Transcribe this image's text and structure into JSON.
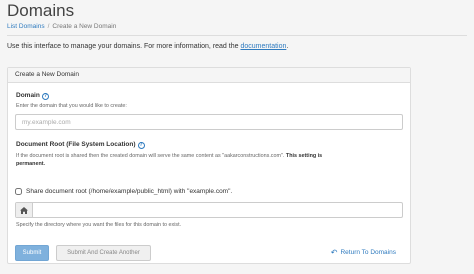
{
  "page": {
    "title": "Domains"
  },
  "breadcrumb": {
    "parent": "List Domains",
    "separator": "/",
    "current": "Create a New Domain"
  },
  "intro": {
    "text_before": "Use this interface to manage your domains. For more information, read the ",
    "link": "documentation",
    "text_after": "."
  },
  "panel": {
    "heading": "Create a New Domain",
    "domain": {
      "label": "Domain",
      "help_icon": "question-circle-icon",
      "hint": "Enter the domain that you would like to create:",
      "placeholder": "my.example.com",
      "value": ""
    },
    "docroot": {
      "label": "Document Root (File System Location)",
      "help_icon": "question-circle-icon",
      "hint_normal": "If the document root is shared then the created domain will serve the same content as \"aakarconstructions.com\". ",
      "hint_bold_1": "This setting is",
      "hint_bold_2": "permanent.",
      "checkbox_label": "Share document root (/home/example/public_html) with \"example.com\".",
      "checkbox_checked": false,
      "addon_icon": "home-icon",
      "value": "",
      "specify_hint": "Specify the directory where you want the files for this domain to exist."
    },
    "buttons": {
      "submit": "Submit",
      "submit_and_create": "Submit And Create Another",
      "return": "Return To Domains",
      "return_icon": "undo-arrow-icon"
    }
  },
  "colors": {
    "link": "#2f7bbf",
    "primary_button": "#7fb1dd"
  }
}
